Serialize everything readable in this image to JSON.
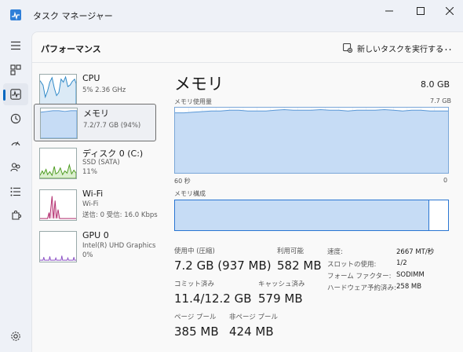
{
  "window": {
    "title": "タスク マネージャー",
    "minimize_icon": "minimize-icon",
    "maximize_icon": "maximize-icon",
    "close_icon": "close-icon"
  },
  "header": {
    "title": "パフォーマンス",
    "run_task_label": "新しいタスクを実行する",
    "more_label": "..."
  },
  "resources": [
    {
      "name": "CPU",
      "sub1": "5%  2.36 GHz",
      "sub2": "",
      "sub3": ""
    },
    {
      "name": "メモリ",
      "sub1": "7.2/7.7 GB (94%)",
      "sub2": "",
      "sub3": ""
    },
    {
      "name": "ディスク 0 (C:)",
      "sub1": "SSD (SATA)",
      "sub2": "11%",
      "sub3": ""
    },
    {
      "name": "Wi-Fi",
      "sub1": "Wi-Fi",
      "sub2": "送信: 0 受信: 16.0 Kbps",
      "sub3": ""
    },
    {
      "name": "GPU 0",
      "sub1": "Intel(R) UHD Graphics",
      "sub2": "0%",
      "sub3": ""
    }
  ],
  "detail": {
    "title": "メモリ",
    "total": "8.0 GB",
    "usage_label": "メモリ使用量",
    "usage_max": "7.7 GB",
    "axis_left": "60 秒",
    "axis_right": "0",
    "composition_label": "メモリ構成",
    "composition_used_fraction": 0.93,
    "usage_fraction_series": [
      0.92,
      0.92,
      0.93,
      0.94,
      0.95,
      0.95,
      0.96,
      0.96,
      0.95,
      0.95,
      0.95,
      0.96,
      0.97,
      0.96,
      0.96,
      0.96,
      0.97,
      0.96,
      0.96,
      0.95,
      0.96,
      0.96,
      0.96,
      0.97,
      0.96,
      0.95,
      0.96,
      0.96,
      0.95,
      0.95,
      0.95
    ]
  },
  "stats": {
    "in_use_label": "使用中 (圧縮)",
    "in_use_value": "7.2 GB (937 MB)",
    "available_label": "利用可能",
    "available_value": "582 MB",
    "committed_label": "コミット済み",
    "committed_value": "11.4/12.2 GB",
    "cached_label": "キャッシュ済み",
    "cached_value": "579 MB",
    "paged_label": "ページ プール",
    "paged_value": "385 MB",
    "nonpaged_label": "非ページ プール",
    "nonpaged_value": "424 MB"
  },
  "props": [
    {
      "label": "速度:",
      "value": "2667 MT/秒"
    },
    {
      "label": "スロットの使用:",
      "value": "1/2"
    },
    {
      "label": "フォーム ファクター:",
      "value": "SODIMM"
    },
    {
      "label": "ハードウェア予約済み:",
      "value": "258 MB"
    }
  ],
  "colors": {
    "accent": "#0067c0",
    "memory_line": "#5a98d6",
    "memory_fill": "#c6dcf5",
    "cpu_line": "#2a86c6",
    "disk_line": "#4b9a1e",
    "wifi_line": "#b22c6e",
    "gpu_line": "#8a4fc4"
  }
}
